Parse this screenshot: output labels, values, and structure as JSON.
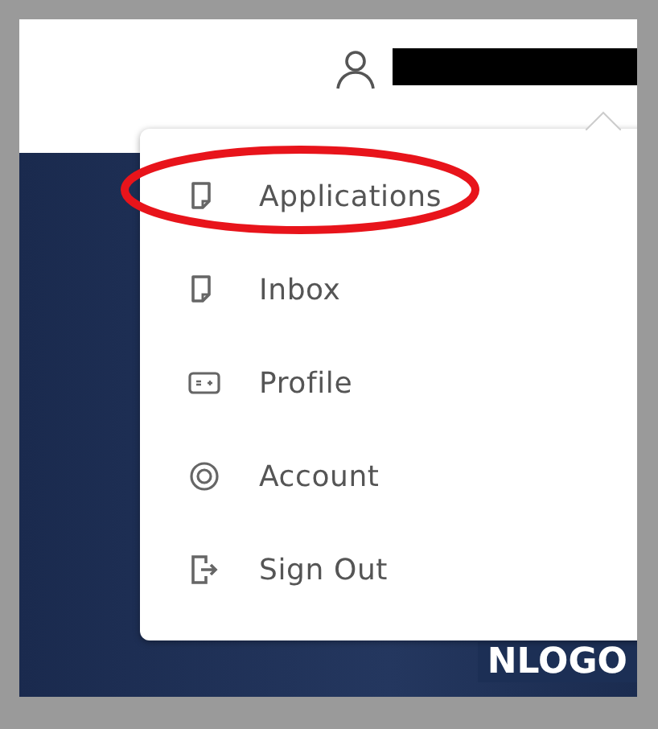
{
  "header": {
    "user_name_redacted": true
  },
  "user_menu": {
    "items": [
      {
        "label": "Applications",
        "kind": "document",
        "circled": true
      },
      {
        "label": "Inbox",
        "kind": "document",
        "circled": false
      },
      {
        "label": "Profile",
        "kind": "card",
        "circled": false
      },
      {
        "label": "Account",
        "kind": "ring",
        "circled": false
      },
      {
        "label": "Sign Out",
        "kind": "exit",
        "circled": false
      }
    ]
  },
  "banner": {
    "logo_text": "NLOGO"
  }
}
